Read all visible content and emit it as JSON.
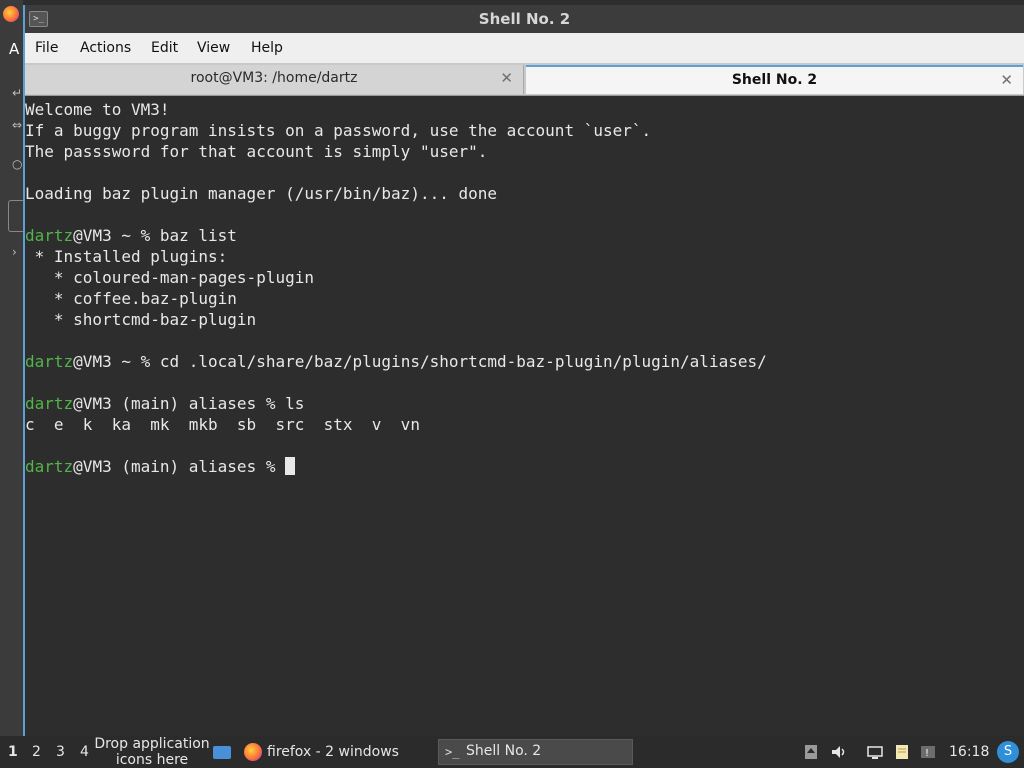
{
  "background": {
    "letter": "A"
  },
  "window": {
    "title": "Shell No. 2",
    "menu": [
      "File",
      "Actions",
      "Edit",
      "View",
      "Help"
    ],
    "tabs": [
      {
        "label": "root@VM3: /home/dartz",
        "active": false
      },
      {
        "label": "Shell No. 2",
        "active": true
      }
    ]
  },
  "terminal": {
    "lines": [
      "Welcome to VM3!",
      "If a buggy program insists on a password, use the account `user`.",
      "The passsword for that account is simply \"user\".",
      "",
      "Loading baz plugin manager (/usr/bin/baz)... done",
      "",
      {
        "user": "dartz",
        "rest": "@VM3 ~ % baz list"
      },
      " * Installed plugins:",
      "   * coloured-man-pages-plugin",
      "   * coffee.baz-plugin",
      "   * shortcmd-baz-plugin",
      "",
      {
        "user": "dartz",
        "rest": "@VM3 ~ % cd .local/share/baz/plugins/shortcmd-baz-plugin/plugin/aliases/"
      },
      "",
      {
        "user": "dartz",
        "rest": "@VM3 (main) aliases % ls"
      },
      "c  e  k  ka  mk  mkb  sb  src  stx  v  vn",
      "",
      {
        "user": "dartz",
        "rest": "@VM3 (main) aliases % ",
        "cursor": true
      }
    ]
  },
  "taskbar": {
    "workspaces": [
      "1",
      "2",
      "3",
      "4"
    ],
    "drop_text": "Drop application icons here",
    "firefox_label": "firefox - 2 windows",
    "active_task": "Shell No. 2",
    "clock": "16:18",
    "colors": {
      "user_prompt": "#53b44a",
      "accent": "#5ea0d6"
    }
  }
}
